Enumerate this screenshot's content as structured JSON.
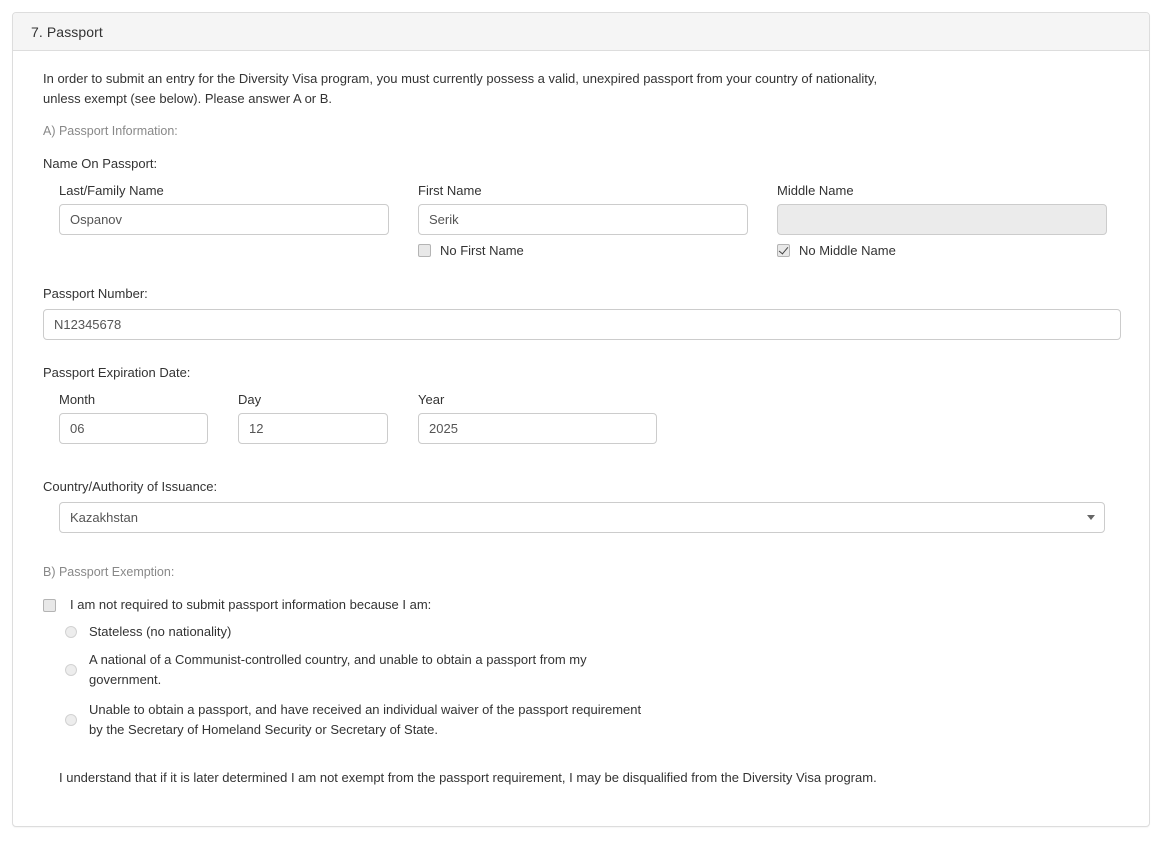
{
  "panel": {
    "title": "7. Passport"
  },
  "intro": {
    "text": "In order to submit an entry for the Diversity Visa program, you must currently possess a valid, unexpired passport from your country of nationality, unless exempt (see below). Please answer A or B."
  },
  "sectionA": {
    "label": "A) Passport Information:",
    "name_on_passport_label": "Name On Passport:",
    "last_name": {
      "label": "Last/Family Name",
      "value": "Ospanov"
    },
    "first_name": {
      "label": "First Name",
      "value": "Serik",
      "checkbox_label": "No First Name",
      "checked": false
    },
    "middle_name": {
      "label": "Middle Name",
      "value": "",
      "checkbox_label": "No Middle Name",
      "checked": true,
      "disabled": true
    },
    "passport_number": {
      "label": "Passport Number:",
      "value": "N12345678"
    },
    "expiration": {
      "label": "Passport Expiration Date:",
      "month": {
        "label": "Month",
        "value": "06"
      },
      "day": {
        "label": "Day",
        "value": "12"
      },
      "year": {
        "label": "Year",
        "value": "2025"
      }
    },
    "country": {
      "label": "Country/Authority of Issuance:",
      "value": "Kazakhstan"
    }
  },
  "sectionB": {
    "label": "B) Passport Exemption:",
    "exempt_checkbox_label": "I am not required to submit passport information because I am:",
    "exempt_checked": false,
    "options": [
      {
        "text": "Stateless (no nationality)",
        "selected": false
      },
      {
        "text": "A national of a Communist-controlled country, and unable to obtain a passport from my government.",
        "selected": false
      },
      {
        "text": "Unable to obtain a passport, and have received an individual waiver of the passport requirement by the Secretary of Homeland Security or Secretary of State.",
        "selected": false
      }
    ],
    "understand_text": "I understand that if it is later determined I am not exempt from the passport requirement, I may be disqualified from the Diversity Visa program."
  },
  "colors": {
    "panel_border": "#dddddd",
    "header_bg": "#f5f5f5",
    "input_border": "#cccccc",
    "disabled_bg": "#ebebeb",
    "muted_text": "#888888",
    "body_text": "#333333"
  }
}
